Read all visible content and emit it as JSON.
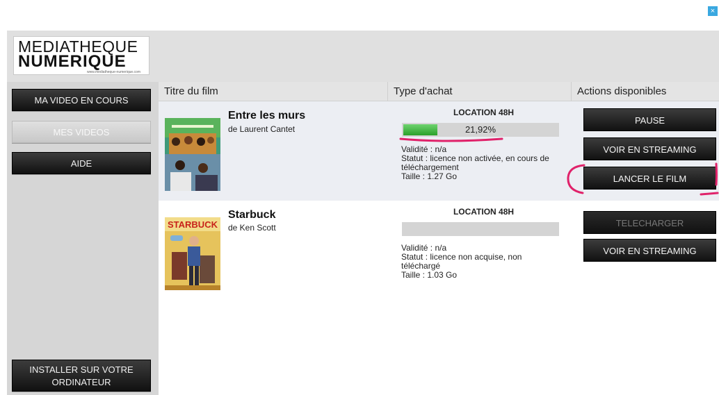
{
  "window": {
    "close_label": "×"
  },
  "logo": {
    "line1": "MEDIATHEQUE",
    "line2": "NUMERIQUE",
    "url": "www.mediatheque-numerique.com"
  },
  "sidebar": {
    "items": [
      {
        "label": "MA VIDEO EN COURS",
        "state": "active"
      },
      {
        "label": "MES VIDEOS",
        "state": "disabled"
      },
      {
        "label": "AIDE",
        "state": "active"
      }
    ],
    "install_label": "INSTALLER SUR VOTRE ORDINATEUR"
  },
  "table": {
    "headers": [
      "Titre du film",
      "Type d'achat",
      "Actions disponibles"
    ],
    "rows": [
      {
        "title": "Entre les murs",
        "director": "de Laurent Cantet",
        "purchase_type": "LOCATION 48H",
        "progress_label": "21,92%",
        "progress_fraction": 0.2192,
        "validity": "Validité : n/a",
        "status": "Statut : licence non activée, en cours de téléchargement",
        "size": "Taille : 1.27 Go",
        "actions": [
          "PAUSE",
          "VOIR EN STREAMING",
          "LANCER LE FILM"
        ]
      },
      {
        "title": "Starbuck",
        "director": "de Ken Scott",
        "purchase_type": "LOCATION 48H",
        "progress_label": "",
        "progress_fraction": 0,
        "validity": "Validité : n/a",
        "status": "Statut : licence non acquise, non téléchargé",
        "size": "Taille : 1.03 Go",
        "actions": [
          "TELECHARGER",
          "VOIR EN STREAMING"
        ]
      }
    ]
  },
  "colors": {
    "progress_fill": "#3cb043",
    "annotation": "#e0226a",
    "accent_close": "#3aa8e0"
  }
}
